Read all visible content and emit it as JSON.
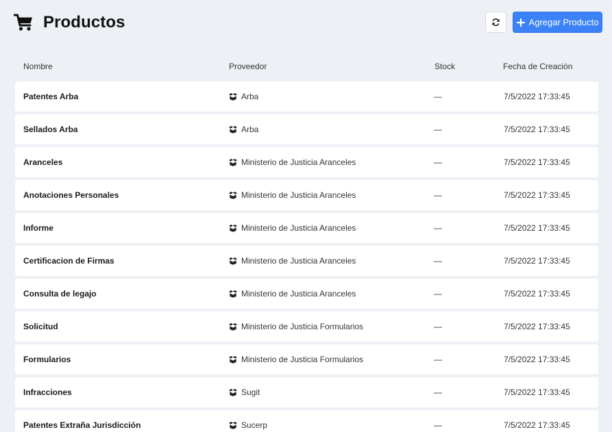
{
  "header": {
    "title": "Productos",
    "add_label": "Agregar Producto",
    "accent": "#3b82f6"
  },
  "icons": {
    "title": "shopping-cart-icon",
    "refresh": "refresh-icon",
    "add": "plus-icon",
    "provider": "box-icon"
  },
  "table": {
    "columns": [
      "Nombre",
      "Proveedor",
      "Stock",
      "Fecha de Creación"
    ],
    "rows": [
      {
        "nombre": "Patentes Arba",
        "proveedor": "Arba",
        "stock": "—",
        "fecha": "7/5/2022 17:33:45"
      },
      {
        "nombre": "Sellados Arba",
        "proveedor": "Arba",
        "stock": "—",
        "fecha": "7/5/2022 17:33:45"
      },
      {
        "nombre": "Aranceles",
        "proveedor": "Ministerio de Justicia Aranceles",
        "stock": "—",
        "fecha": "7/5/2022 17:33:45"
      },
      {
        "nombre": "Anotaciones Personales",
        "proveedor": "Ministerio de Justicia Aranceles",
        "stock": "—",
        "fecha": "7/5/2022 17:33:45"
      },
      {
        "nombre": "Informe",
        "proveedor": "Ministerio de Justicia Aranceles",
        "stock": "—",
        "fecha": "7/5/2022 17:33:45"
      },
      {
        "nombre": "Certificacion de Firmas",
        "proveedor": "Ministerio de Justicia Aranceles",
        "stock": "—",
        "fecha": "7/5/2022 17:33:45"
      },
      {
        "nombre": "Consulta de legajo",
        "proveedor": "Ministerio de Justicia Aranceles",
        "stock": "—",
        "fecha": "7/5/2022 17:33:45"
      },
      {
        "nombre": "Solicitud",
        "proveedor": "Ministerio de Justicia Formularios",
        "stock": "—",
        "fecha": "7/5/2022 17:33:45"
      },
      {
        "nombre": "Formularios",
        "proveedor": "Ministerio de Justicia Formularios",
        "stock": "—",
        "fecha": "7/5/2022 17:33:45"
      },
      {
        "nombre": "Infracciones",
        "proveedor": "Sugit",
        "stock": "—",
        "fecha": "7/5/2022 17:33:45"
      },
      {
        "nombre": "Patentes Extraña Jurisdicción",
        "proveedor": "Sucerp",
        "stock": "—",
        "fecha": "7/5/2022 17:33:45"
      }
    ]
  }
}
